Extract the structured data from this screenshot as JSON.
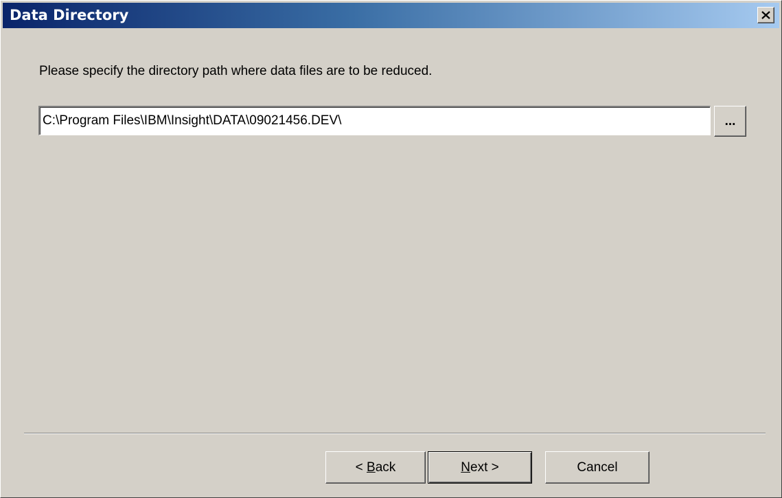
{
  "window": {
    "title": "Data Directory"
  },
  "prompt": "Please specify the directory path where data files are to be reduced.",
  "path_field": {
    "value": "C:\\Program Files\\IBM\\Insight\\DATA\\09021456.DEV\\"
  },
  "browse_button": {
    "label": "..."
  },
  "buttons": {
    "back": {
      "prefix": "< ",
      "accel": "B",
      "rest": "ack"
    },
    "next": {
      "accel": "N",
      "rest": "ext >"
    },
    "cancel": "Cancel"
  },
  "colors": {
    "title_start": "#0a246a",
    "title_end": "#a6caf0",
    "dialog_bg": "#d4d0c8"
  }
}
